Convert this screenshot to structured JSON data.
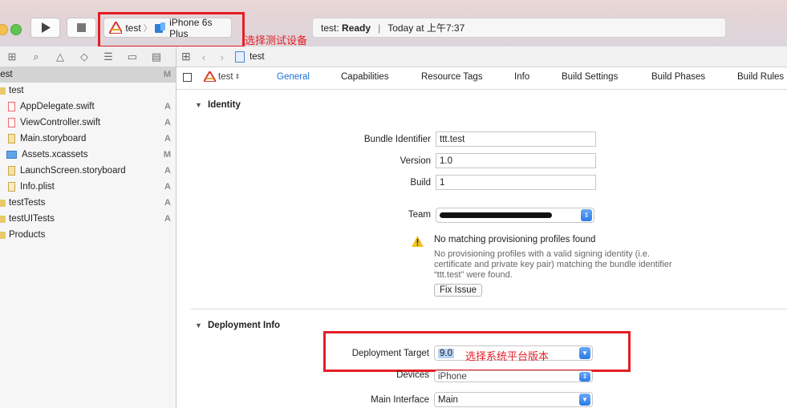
{
  "toolbar": {
    "scheme_target": "test",
    "scheme_device": "iPhone 6s Plus",
    "status_name": "test:",
    "status_state": "Ready",
    "status_sep": "|",
    "status_time": "Today at 上午7:37",
    "annotation_device": "选择测试设备"
  },
  "navigator": {
    "root": {
      "label": "test",
      "status": "M"
    },
    "items": [
      {
        "label": "test",
        "status": "",
        "kind": "folder"
      },
      {
        "label": "AppDelegate.swift",
        "status": "A",
        "kind": "swift"
      },
      {
        "label": "ViewController.swift",
        "status": "A",
        "kind": "swift"
      },
      {
        "label": "Main.storyboard",
        "status": "A",
        "kind": "storyboard"
      },
      {
        "label": "Assets.xcassets",
        "status": "M",
        "kind": "assets"
      },
      {
        "label": "LaunchScreen.storyboard",
        "status": "A",
        "kind": "storyboard"
      },
      {
        "label": "Info.plist",
        "status": "A",
        "kind": "plist"
      },
      {
        "label": "testTests",
        "status": "A",
        "kind": "folder"
      },
      {
        "label": "testUITests",
        "status": "A",
        "kind": "folder"
      },
      {
        "label": "Products",
        "status": "",
        "kind": "folder"
      }
    ]
  },
  "jumpbar": {
    "file": "test"
  },
  "tabs": {
    "target": "test",
    "items": [
      "General",
      "Capabilities",
      "Resource Tags",
      "Info",
      "Build Settings",
      "Build Phases",
      "Build Rules"
    ],
    "active": "General"
  },
  "identity": {
    "title": "Identity",
    "bundle_label": "Bundle Identifier",
    "bundle_value": "ttt.test",
    "version_label": "Version",
    "version_value": "1.0",
    "build_label": "Build",
    "build_value": "1",
    "team_label": "Team",
    "warning_title": "No matching provisioning profiles found",
    "warning_line1": "No provisioning profiles with a valid signing identity (i.e.",
    "warning_line2": "certificate and private key pair) matching the bundle identifier",
    "warning_line3": "“ttt.test” were found.",
    "fix_button": "Fix Issue"
  },
  "deployment": {
    "title": "Deployment Info",
    "target_label": "Deployment Target",
    "target_value": "9.0",
    "devices_label": "Devices",
    "devices_value": "iPhone",
    "main_label": "Main Interface",
    "main_value": "Main",
    "annotation": "选择系统平台版本"
  },
  "colors": {
    "accent": "#1a6fd7",
    "annotation": "#e51d25"
  }
}
